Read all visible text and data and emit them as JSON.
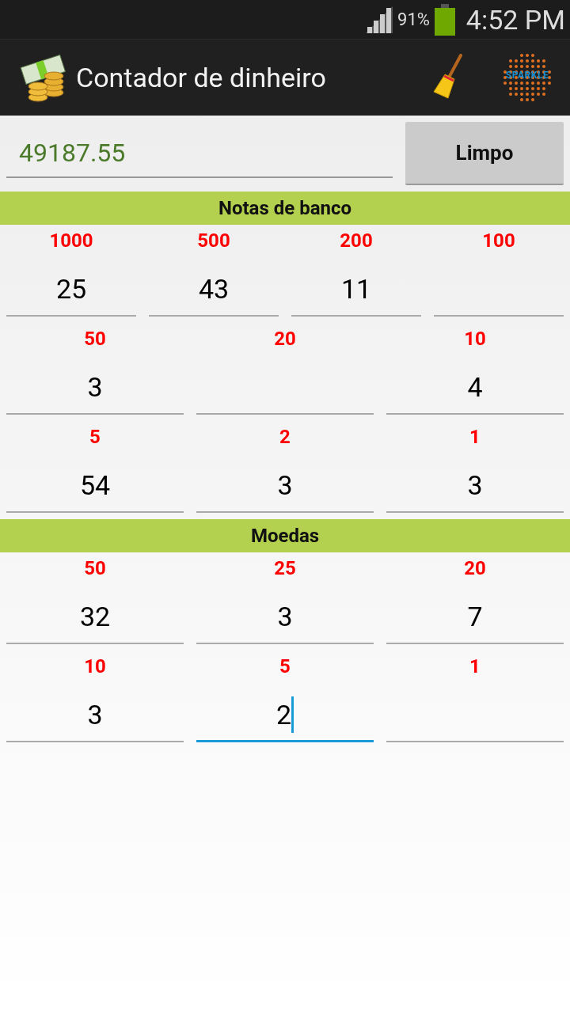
{
  "status_bar": {
    "battery": "91%",
    "time": "4:52 PM"
  },
  "action_bar": {
    "title": "Contador de dinheiro",
    "logo_text": "SPARKLE"
  },
  "total": {
    "value": "49187.55"
  },
  "clear_button": "Limpo",
  "sections": [
    {
      "title": "Notas de banco",
      "rows": [
        [
          {
            "label": "1000",
            "value": "25",
            "focused": false
          },
          {
            "label": "500",
            "value": "43",
            "focused": false
          },
          {
            "label": "200",
            "value": "11",
            "focused": false
          },
          {
            "label": "100",
            "focused": false
          }
        ],
        [
          {
            "label": "50",
            "value": "3",
            "focused": false
          },
          {
            "label": "20",
            "focused": false
          },
          {
            "label": "10",
            "value": "4",
            "focused": false
          }
        ],
        [
          {
            "label": "5",
            "value": "54",
            "focused": false
          },
          {
            "label": "2",
            "value": "3",
            "focused": false
          },
          {
            "label": "1",
            "value": "3",
            "focused": false
          }
        ]
      ]
    },
    {
      "title": "Moedas",
      "rows": [
        [
          {
            "label": "50",
            "value": "32",
            "focused": false
          },
          {
            "label": "25",
            "value": "3",
            "focused": false
          },
          {
            "label": "20",
            "value": "7",
            "focused": false
          }
        ],
        [
          {
            "label": "10",
            "value": "3",
            "focused": false
          },
          {
            "label": "5",
            "value": "2",
            "focused": true
          },
          {
            "label": "1",
            "focused": false
          }
        ]
      ]
    }
  ]
}
